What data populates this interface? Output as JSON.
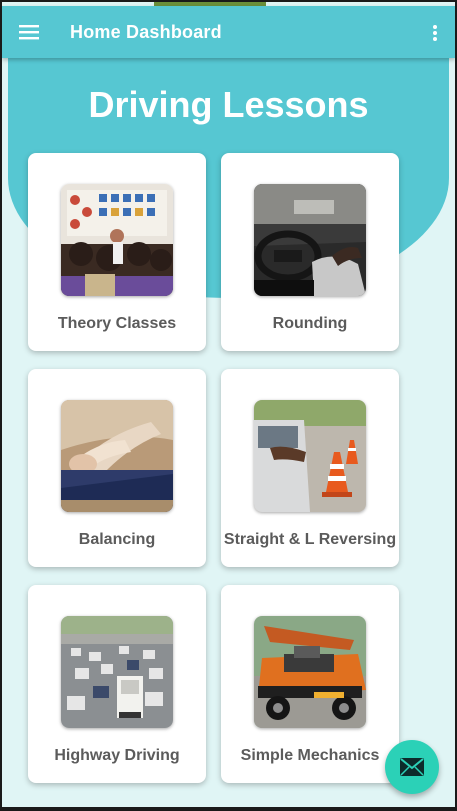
{
  "app_bar": {
    "title": "Home Dashboard",
    "menu_icon": "hamburger-menu-icon",
    "more_icon": "more-vert-icon",
    "color": "#56c7d2"
  },
  "main": {
    "title": "Driving Lessons"
  },
  "lessons": [
    {
      "label": "Theory Classes",
      "image": "classroom-photo"
    },
    {
      "label": "Rounding",
      "image": "steering-wheel-photo"
    },
    {
      "label": "Balancing",
      "image": "handbrake-photo"
    },
    {
      "label": "Straight & L Reversing",
      "image": "traffic-cones-photo"
    },
    {
      "label": "Highway Driving",
      "image": "highway-traffic-photo"
    },
    {
      "label": "Simple Mechanics",
      "image": "car-engine-photo"
    }
  ],
  "fab": {
    "icon": "mail-icon",
    "color": "#2bd1b7"
  }
}
